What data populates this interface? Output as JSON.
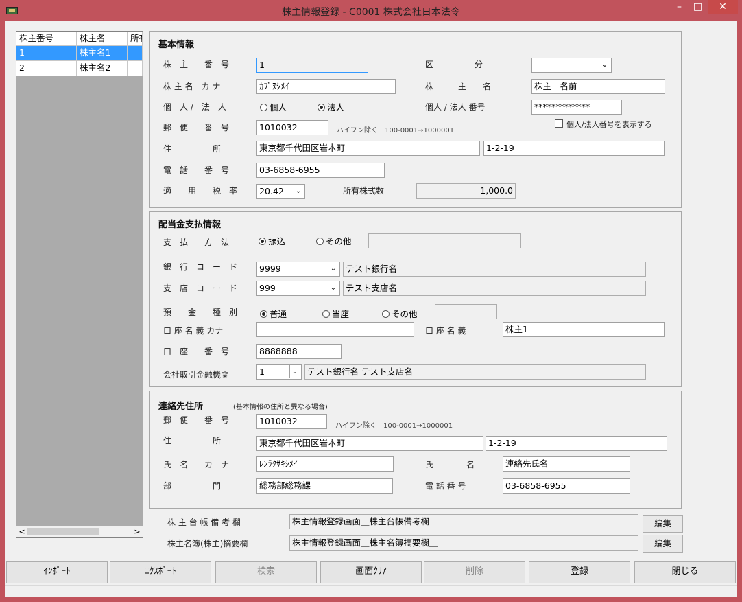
{
  "window": {
    "title": "株主情報登録 - C0001 株式会社日本法令",
    "min_glyph": "–",
    "max_glyph": "□",
    "close_glyph": "✕"
  },
  "grid": {
    "columns": [
      "株主番号",
      "株主名",
      "所有"
    ],
    "rows": [
      [
        "1",
        "株主名1",
        ""
      ],
      [
        "2",
        "株主名2",
        ""
      ]
    ],
    "scroll_left": "<",
    "scroll_right": ">"
  },
  "basic": {
    "title": "基本情報",
    "holder_no_label": "株　主　　番　号",
    "holder_no": "1",
    "category_label": "区　　　　　分",
    "category_value": "",
    "kana_label": "株 主 名　カ ナ",
    "kana": "ｶﾌﾞﾇｼﾒｲ",
    "name_label": "株　　　主　　名",
    "name": "株主　名前",
    "type_label": "個　人 /　法　人",
    "type_individual": "個人",
    "type_corporate": "法人",
    "id_no_label": "個人 / 法人 番号",
    "id_no": "*************",
    "show_id_label": "個人/法人番号を表示する",
    "postal_label": "郵　便　　番　号",
    "postal": "1010032",
    "postal_hint": "ハイフン除く　100-0001→1000001",
    "address_label": "住　　　　　所",
    "address1": "東京都千代田区岩本町",
    "address2": "1-2-19",
    "phone_label": "電　話　　番　号",
    "phone": "03-6858-6955",
    "tax_label": "適　　用　　税　率",
    "tax_rate": "20.42",
    "shares_label": "所有株式数",
    "shares": "1,000.0"
  },
  "dividend": {
    "title": "配当金支払情報",
    "method_label": "支　払　　方　法",
    "method_transfer": "振込",
    "method_other": "その他",
    "method_other_value": "",
    "bank_code_label": "銀　行　コ　ー　ド",
    "bank_code": "9999",
    "bank_name": "テスト銀行名",
    "branch_code_label": "支　店　コ　ー　ド",
    "branch_code": "999",
    "branch_name": "テスト支店名",
    "deposit_label": "預　　金　　種　別",
    "deposit_normal": "普通",
    "deposit_current": "当座",
    "deposit_other": "その他",
    "deposit_other_value": "",
    "account_kana_label": "口 座 名 義 カナ",
    "account_kana": "",
    "account_name_label": "口 座 名 義",
    "account_name": "株主1",
    "account_no_label": "口　座　　番　号",
    "account_no": "8888888",
    "fin_label": "会社取引金融機関",
    "fin_value": "1",
    "fin_name": "テスト銀行名 テスト支店名"
  },
  "contact": {
    "title": "連絡先住所",
    "subtitle": "(基本情報の住所と異なる場合)",
    "postal_label": "郵　便　　番　号",
    "postal": "1010032",
    "postal_hint": "ハイフン除く　100-0001→1000001",
    "address_label": "住　　　　　所",
    "address1": "東京都千代田区岩本町",
    "address2": "1-2-19",
    "kana_label": "氏　名　　カ　ナ",
    "kana": "ﾚﾝﾗｸｻｷｼﾒｲ",
    "name_label": "氏　　　　名",
    "name": "連絡先氏名",
    "dept_label": "部　　　　　門",
    "dept": "総務部総務課",
    "phone_label": "電 話 番 号",
    "phone": "03-6858-6955"
  },
  "notes": {
    "ledger_label": "株 主 台 帳 備 考 欄",
    "ledger_value": "株主情報登録画面＿株主台帳備考欄",
    "ledger_edit": "編集",
    "register_label": "株主名簿(株主)摘要欄",
    "register_value": "株主情報登録画面＿株主名簿摘要欄＿",
    "register_edit": "編集"
  },
  "footer": {
    "import": "ｲﾝﾎﾟｰﾄ",
    "export": "ｴｸｽﾎﾟｰﾄ",
    "search": "検索",
    "clear": "画面ｸﾘｱ",
    "delete": "削除",
    "register": "登録",
    "close": "閉じる"
  }
}
